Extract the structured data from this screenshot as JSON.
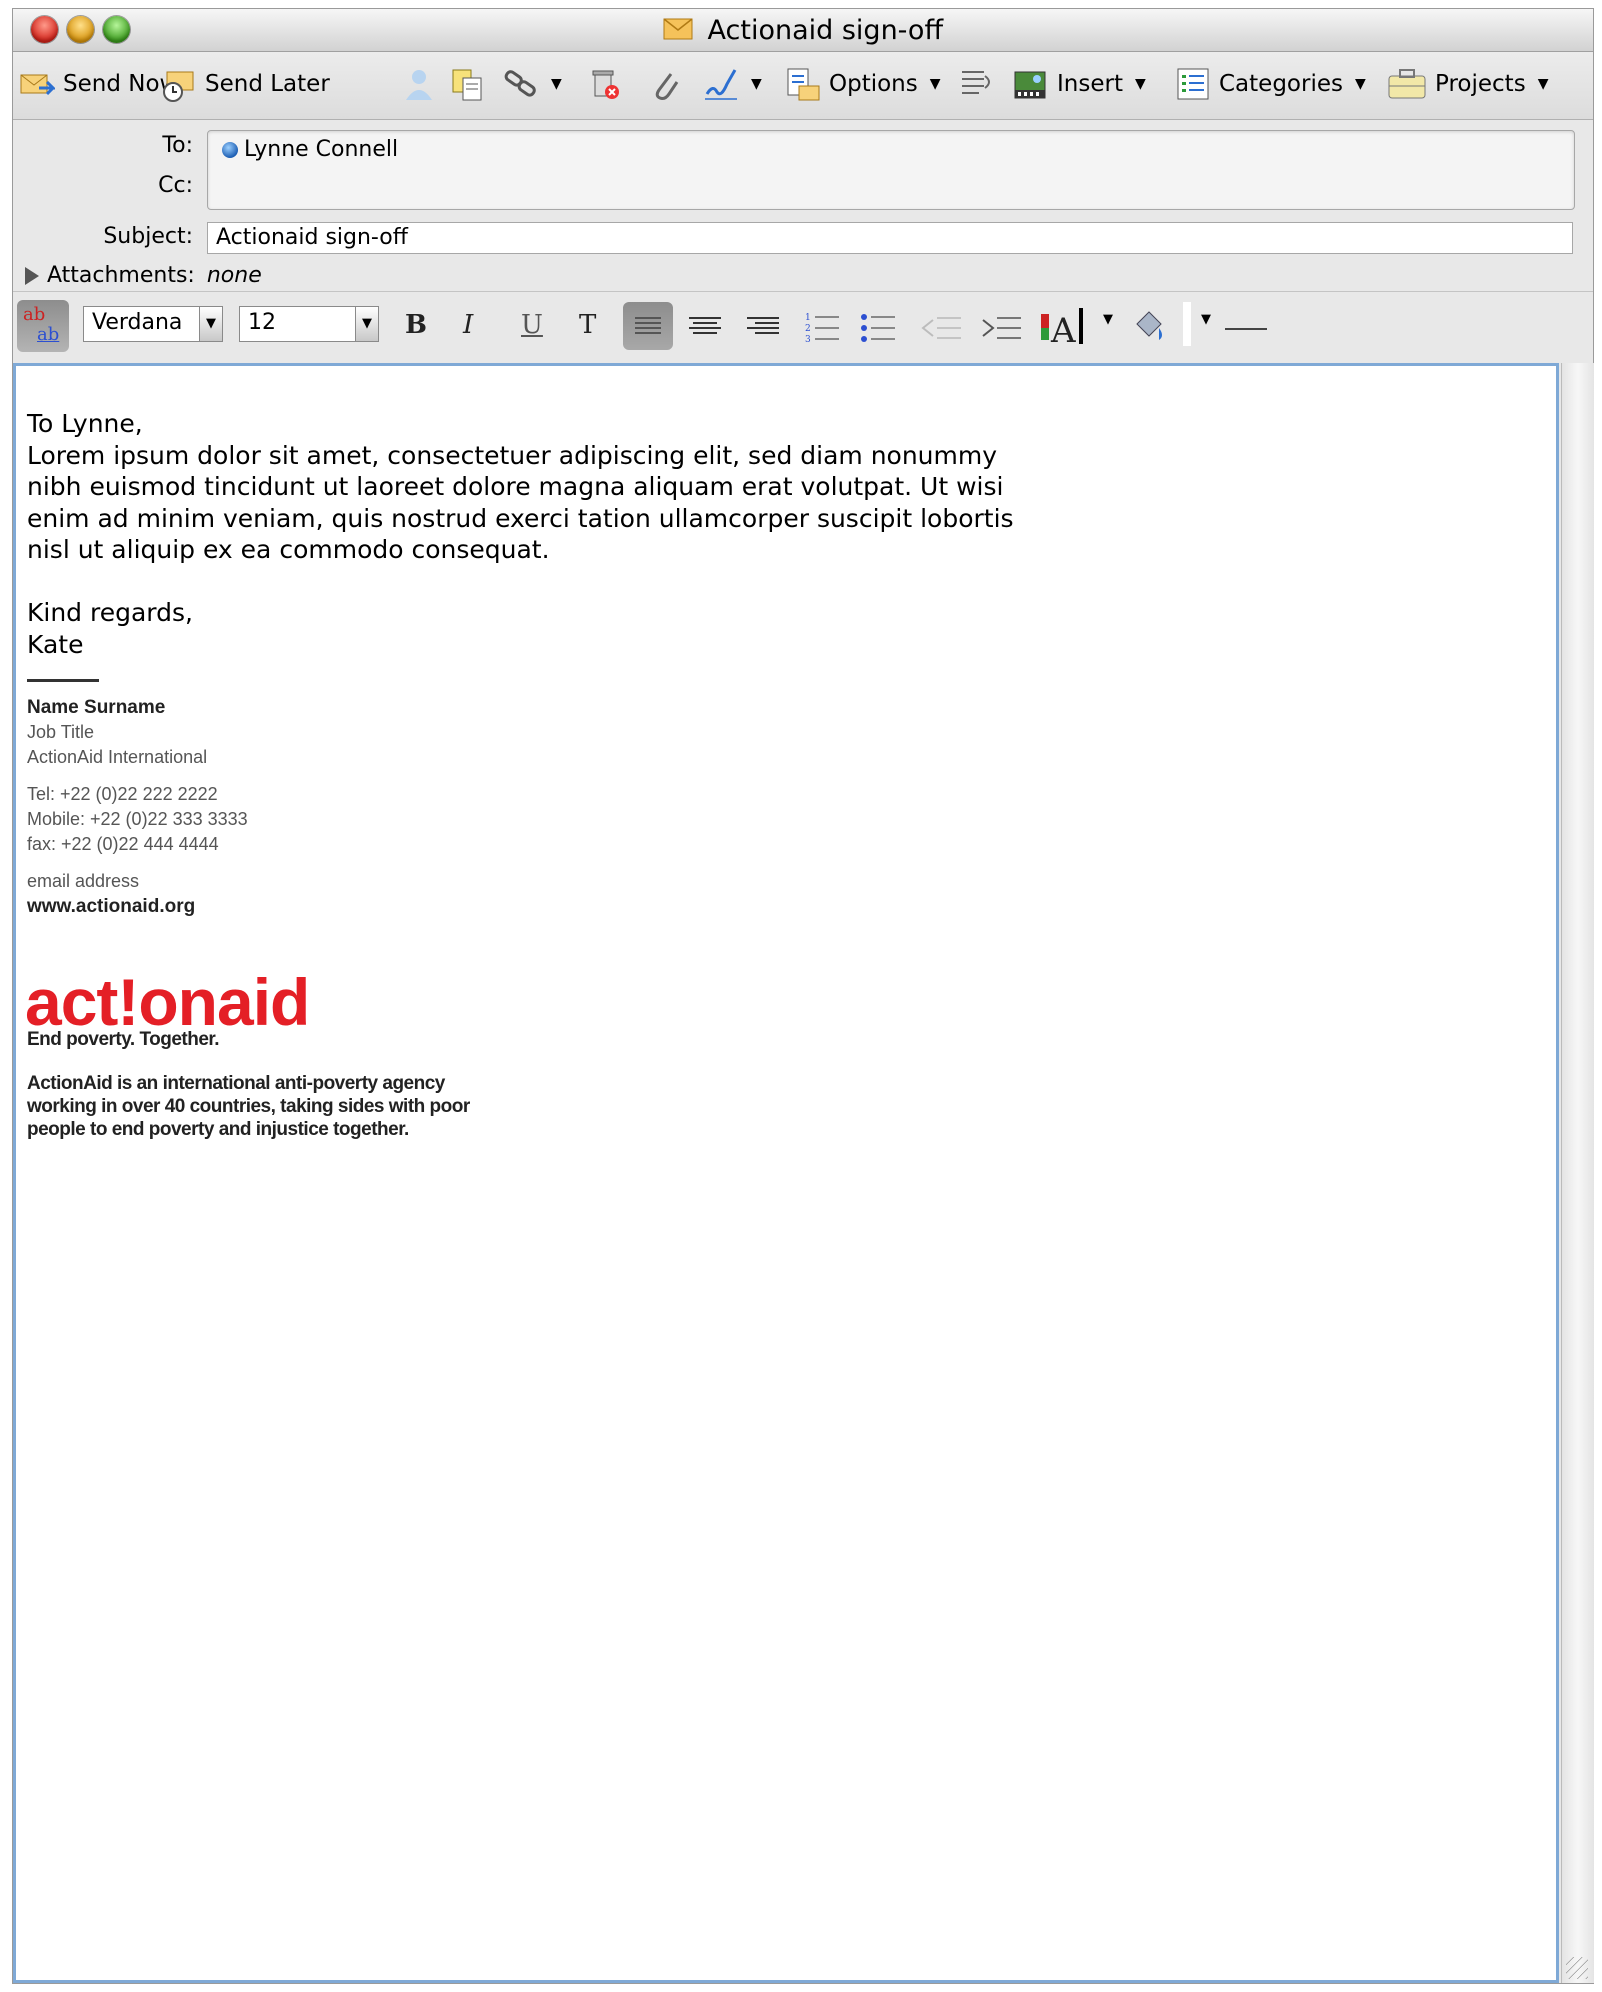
{
  "window": {
    "title": "Actionaid sign-off"
  },
  "toolbar": {
    "send_now": "Send Now",
    "send_later": "Send Later",
    "options": "Options",
    "insert": "Insert",
    "categories": "Categories",
    "projects": "Projects"
  },
  "header": {
    "to_label": "To:",
    "cc_label": "Cc:",
    "subject_label": "Subject:",
    "to_recipient": "Lynne Connell",
    "cc_value": "",
    "subject_value": "Actionaid sign-off",
    "attachments_label": "Attachments:",
    "attachments_value": "none"
  },
  "format": {
    "font": "Verdana",
    "size": "12",
    "bold": "B",
    "italic": "I",
    "underline": "U",
    "text": "T"
  },
  "message": {
    "greeting": "To Lynne,",
    "body_lines": [
      "Lorem ipsum dolor sit amet, consectetuer adipiscing elit, sed diam nonummy",
      "nibh euismod tincidunt ut laoreet dolore magna aliquam erat volutpat. Ut wisi",
      "enim ad minim veniam, quis nostrud exerci tation ullamcorper suscipit lobortis",
      "nisl ut aliquip ex ea commodo consequat."
    ],
    "closing": "Kind regards,",
    "sender": "Kate"
  },
  "signature": {
    "name": "Name Surname",
    "job_title": "Job Title",
    "organization": "ActionAid International",
    "tel": "Tel: +22 (0)22 222 2222",
    "mobile": "Mobile: +22 (0)22 333 3333",
    "fax": "fax: +22 (0)22 444 4444",
    "email": "email address",
    "website": "www.actionaid.org",
    "logo_text": "act!onaid",
    "tagline": "End poverty. Together.",
    "about": "ActionAid is an international anti-poverty agency working in over 40 countries, taking sides with poor people to end poverty and injustice together."
  },
  "colors": {
    "logo_red": "#e41f26",
    "editor_focus": "#7fa9d6"
  }
}
